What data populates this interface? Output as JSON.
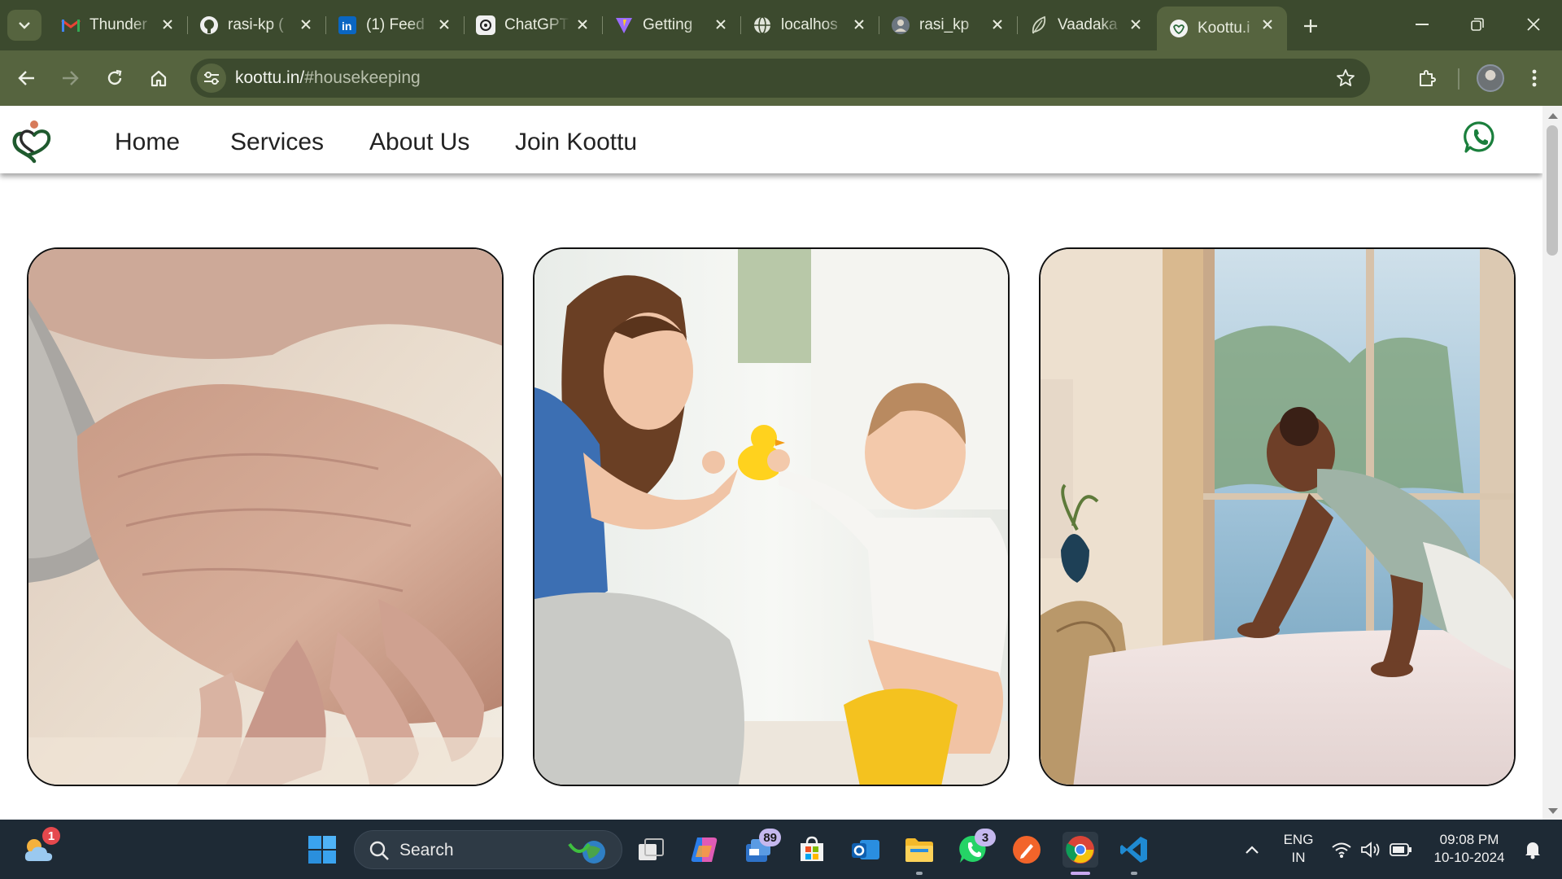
{
  "browser": {
    "tabs": [
      {
        "title": "Thunder",
        "icon": "gmail-icon"
      },
      {
        "title": "rasi-kp (",
        "icon": "github-icon"
      },
      {
        "title": "(1) Feed",
        "icon": "linkedin-icon"
      },
      {
        "title": "ChatGPT",
        "icon": "chatgpt-icon"
      },
      {
        "title": "Getting",
        "icon": "vite-icon"
      },
      {
        "title": "localhos",
        "icon": "globe-icon"
      },
      {
        "title": "rasi_kp",
        "icon": "avatar-icon"
      },
      {
        "title": "Vaadaka",
        "icon": "leaf-icon"
      },
      {
        "title": "Koottu.i",
        "icon": "koottu-logo-icon",
        "active": true
      }
    ],
    "address": {
      "host": "koottu.in/",
      "path": "#housekeeping"
    }
  },
  "site": {
    "nav": {
      "home": "Home",
      "services": "Services",
      "about": "About Us",
      "join": "Join Koottu"
    },
    "brand_color": "#1f6b3a",
    "whatsapp_color": "#1a7f3c",
    "cards": [
      {
        "name": "elder-care-card",
        "subject": "elderly hands"
      },
      {
        "name": "child-care-card",
        "subject": "woman playing with baby"
      },
      {
        "name": "housekeeping-card",
        "subject": "housekeeper making bed"
      }
    ]
  },
  "taskbar": {
    "weather_badge": "1",
    "search_label": "Search",
    "apps": [
      {
        "name": "task-view-icon"
      },
      {
        "name": "copilot-icon"
      },
      {
        "name": "teams-icon",
        "badge": "89"
      },
      {
        "name": "store-icon"
      },
      {
        "name": "outlook-icon"
      },
      {
        "name": "file-explorer-icon"
      },
      {
        "name": "whatsapp-icon",
        "badge": "3"
      },
      {
        "name": "pen-icon"
      },
      {
        "name": "chrome-icon"
      },
      {
        "name": "vscode-icon"
      }
    ],
    "lang_top": "ENG",
    "lang_bottom": "IN",
    "time": "09:08 PM",
    "date": "10-10-2024"
  }
}
